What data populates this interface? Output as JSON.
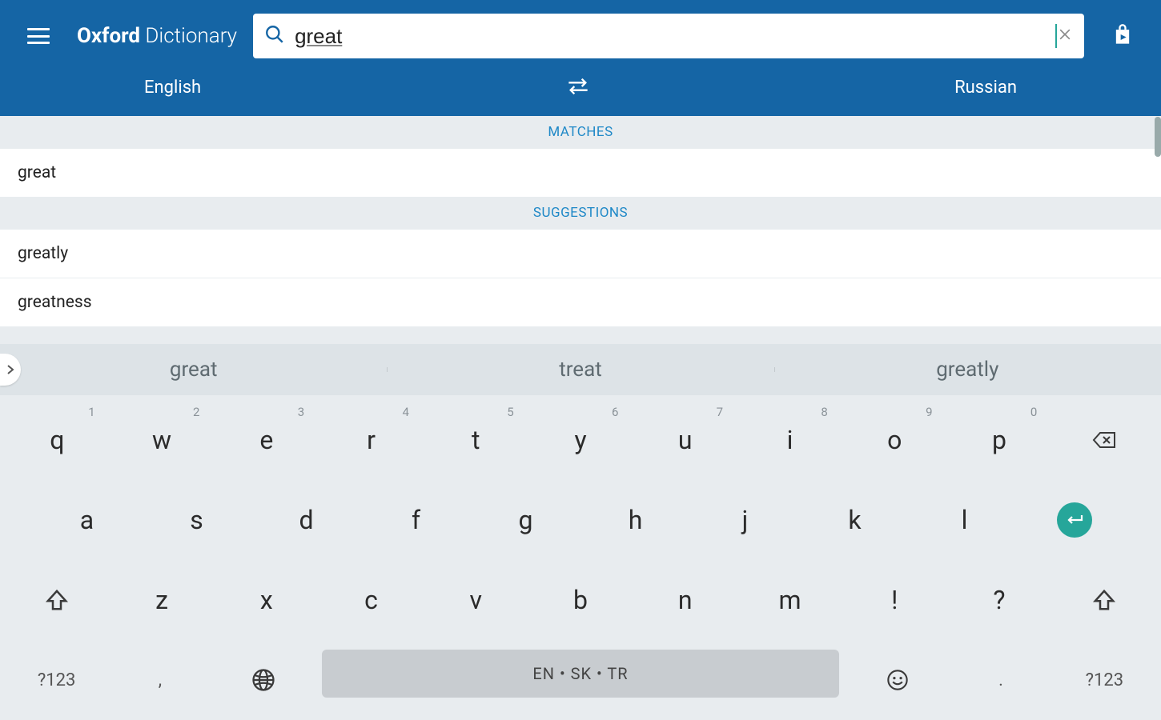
{
  "header": {
    "title_bold": "Oxford",
    "title_light": " Dictionary",
    "search_value": "great",
    "lang_from": "English",
    "lang_to": "Russian"
  },
  "results": {
    "matches_header": "MATCHES",
    "matches": [
      "great"
    ],
    "suggestions_header": "SUGGESTIONS",
    "suggestions": [
      "greatly",
      "greatness"
    ]
  },
  "keyboard": {
    "suggestions": [
      "great",
      "treat",
      "greatly"
    ],
    "row1": [
      {
        "k": "q",
        "n": "1"
      },
      {
        "k": "w",
        "n": "2"
      },
      {
        "k": "e",
        "n": "3"
      },
      {
        "k": "r",
        "n": "4"
      },
      {
        "k": "t",
        "n": "5"
      },
      {
        "k": "y",
        "n": "6"
      },
      {
        "k": "u",
        "n": "7"
      },
      {
        "k": "i",
        "n": "8"
      },
      {
        "k": "o",
        "n": "9"
      },
      {
        "k": "p",
        "n": "0"
      }
    ],
    "row2": [
      "a",
      "s",
      "d",
      "f",
      "g",
      "h",
      "j",
      "k",
      "l"
    ],
    "row3": [
      "z",
      "x",
      "c",
      "v",
      "b",
      "n",
      "m",
      "!",
      "?"
    ],
    "symkey": "?123",
    "comma": ",",
    "period": ".",
    "space_label": "EN • SK • TR"
  }
}
